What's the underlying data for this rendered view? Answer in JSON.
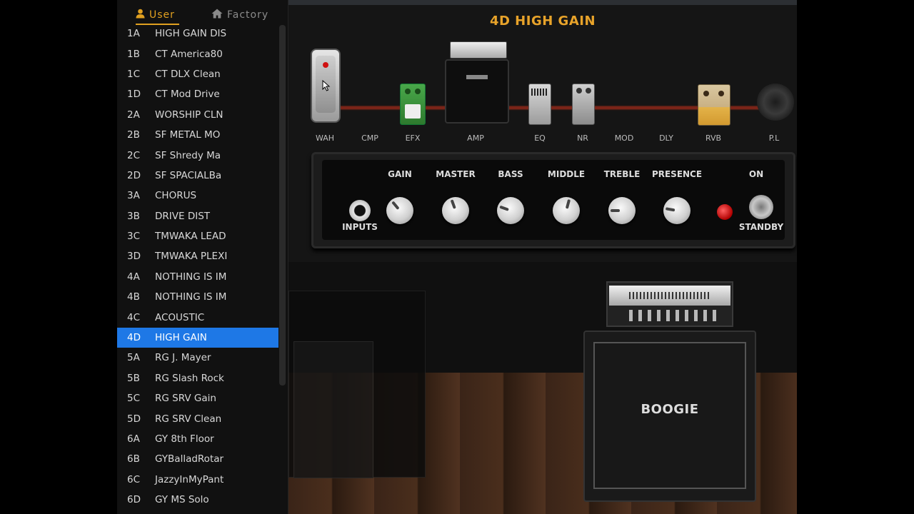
{
  "sidebar": {
    "tabs": [
      {
        "label": "User",
        "icon": "user-icon"
      },
      {
        "label": "Factory",
        "icon": "home-icon"
      }
    ],
    "presets": [
      {
        "num": "1A",
        "name": "HIGH GAIN DIS"
      },
      {
        "num": "1B",
        "name": "CT America80"
      },
      {
        "num": "1C",
        "name": "CT DLX Clean"
      },
      {
        "num": "1D",
        "name": "CT Mod Drive"
      },
      {
        "num": "2A",
        "name": "WORSHIP CLN"
      },
      {
        "num": "2B",
        "name": "SF METAL MO"
      },
      {
        "num": "2C",
        "name": "SF Shredy Ma"
      },
      {
        "num": "2D",
        "name": "SF SPACIALBa"
      },
      {
        "num": "3A",
        "name": "CHORUS"
      },
      {
        "num": "3B",
        "name": "DRIVE  DIST"
      },
      {
        "num": "3C",
        "name": "TMWAKA LEAD"
      },
      {
        "num": "3D",
        "name": "TMWAKA PLEXI"
      },
      {
        "num": "4A",
        "name": "NOTHING IS IM"
      },
      {
        "num": "4B",
        "name": "NOTHING IS IM"
      },
      {
        "num": "4C",
        "name": "ACOUSTIC"
      },
      {
        "num": "4D",
        "name": "HIGH GAIN"
      },
      {
        "num": "5A",
        "name": "RG J. Mayer"
      },
      {
        "num": "5B",
        "name": "RG Slash Rock"
      },
      {
        "num": "5C",
        "name": "RG SRV Gain"
      },
      {
        "num": "5D",
        "name": "RG SRV Clean"
      },
      {
        "num": "6A",
        "name": "GY 8th Floor"
      },
      {
        "num": "6B",
        "name": "GYBalladRotar"
      },
      {
        "num": "6C",
        "name": "JazzyInMyPant"
      },
      {
        "num": "6D",
        "name": "GY MS Solo"
      }
    ],
    "selected": "4D"
  },
  "main": {
    "title": "4D HIGH GAIN",
    "chain": {
      "wah": "WAH",
      "cmp": "CMP",
      "efx": "EFX",
      "amp": "AMP",
      "eq": "EQ",
      "nr": "NR",
      "mod": "MOD",
      "dly": "DLY",
      "rvb": "RVB",
      "pl": "P.L"
    },
    "panel": {
      "inputs": "INPUTS",
      "gain": "GAIN",
      "master": "MASTER",
      "bass": "BASS",
      "middle": "MIDDLE",
      "treble": "TREBLE",
      "presence": "PRESENCE",
      "on": "ON",
      "standby": "STANDBY"
    },
    "cabinet": "BOOGIE"
  },
  "colors": {
    "accent": "#e8a32a",
    "selection": "#1e78e6",
    "cable": "#7a2418"
  }
}
